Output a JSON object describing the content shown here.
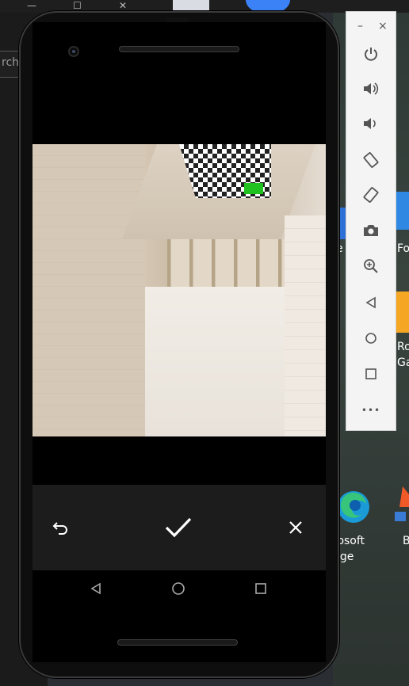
{
  "desktop": {
    "search_partial": "rch",
    "window_controls": [
      "—",
      "☐",
      "✕"
    ],
    "label_e": "e",
    "label_fo": "Fo",
    "label_ro": "Ro",
    "label_ga": "Ga",
    "edge_label_line1": "rosoft",
    "edge_label_line2": "dge",
    "label_b": "B"
  },
  "emulator_toolbar": {
    "minimize": "–",
    "close": "×",
    "more": "•••"
  },
  "camera_review": {
    "accent_marker_color": "#1fc21f"
  },
  "icons": {
    "back_action": "undo-arrow-icon",
    "confirm_action": "check-icon",
    "cancel_action": "close-icon",
    "nav_back": "triangle-back-icon",
    "nav_home": "circle-home-icon",
    "nav_recents": "square-recents-icon"
  }
}
